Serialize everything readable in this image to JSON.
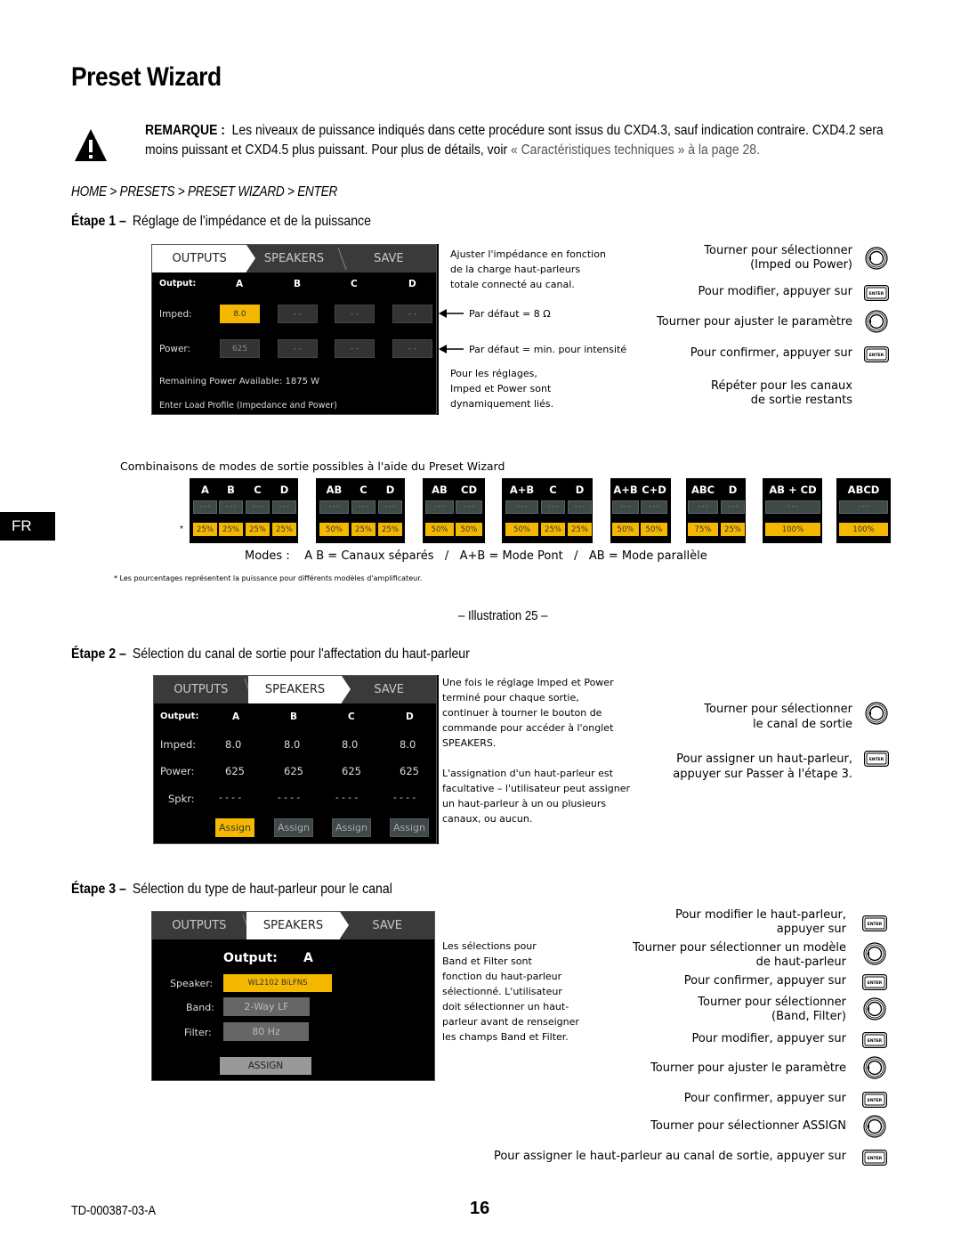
{
  "title": "Preset Wizard",
  "note": {
    "label": "REMARQUE :",
    "text": "Les niveaux de puissance indiqués dans cette procédure sont issus du CXD4.3, sauf indication contraire. CXD4.2 sera moins puissant et CXD4.5 plus puissant. Pour plus de détails, voir",
    "link": "« Caractéristiques techniques » à la page 28.",
    "icon": "warning-icon"
  },
  "breadcrumb": "HOME > PRESETS > PRESET WIZARD > ENTER",
  "step1": {
    "label": "Étape 1 –",
    "title": "Réglage de l'impédance et de la puissance",
    "screen": {
      "tabs": [
        "OUTPUTS",
        "SPEAKERS",
        "SAVE"
      ],
      "active_tab": "OUTPUTS",
      "output_label": "Output:",
      "channels": [
        "A",
        "B",
        "C",
        "D"
      ],
      "imped_label": "Imped:",
      "imped_values": [
        "8.0",
        "- -",
        "- -",
        "- -"
      ],
      "power_label": "Power:",
      "power_values": [
        "625",
        "- -",
        "- -",
        "- -"
      ],
      "remaining": "Remaining Power Available:  1875 W",
      "footer": "Enter Load Profile (Impedance and Power)"
    },
    "desc_top": [
      "Ajuster l'impédance en fonction",
      "de la charge haut-parleurs",
      "totale connecté au canal."
    ],
    "arrow_imped": "Par défaut = 8 Ω",
    "arrow_power": "Par défaut = min. pour intensité",
    "desc_bottom": [
      "Pour les réglages,",
      "Imped et Power sont",
      "dynamiquement liés."
    ],
    "instructions": [
      {
        "text": [
          "Tourner pour sélectionner",
          "(Imped ou Power)"
        ],
        "icon": "knob"
      },
      {
        "text": [
          "Pour modifier, appuyer sur"
        ],
        "icon": "enter"
      },
      {
        "text": [
          "Tourner pour ajuster le paramètre"
        ],
        "icon": "knob"
      },
      {
        "text": [
          "Pour confirmer, appuyer sur"
        ],
        "icon": "enter"
      },
      {
        "text": [
          "Répéter pour les canaux",
          "de sortie restants"
        ],
        "icon": ""
      }
    ]
  },
  "combos": {
    "caption": "Combinaisons de modes de sortie possibles à l'aide du Preset Wizard",
    "asterisk": "*",
    "dots": "- - -",
    "groups": [
      {
        "headers": [
          "A",
          "B",
          "C",
          "D"
        ],
        "percents": [
          "25%",
          "25%",
          "25%",
          "25%"
        ]
      },
      {
        "headers": [
          "AB",
          "C",
          "D"
        ],
        "percents": [
          "50%",
          "25%",
          "25%"
        ]
      },
      {
        "headers": [
          "AB",
          "CD"
        ],
        "percents": [
          "50%",
          "50%"
        ]
      },
      {
        "headers": [
          "A+B",
          "C",
          "D"
        ],
        "percents": [
          "50%",
          "25%",
          "25%"
        ]
      },
      {
        "headers": [
          "A+B",
          "C+D"
        ],
        "percents": [
          "50%",
          "50%"
        ]
      },
      {
        "headers": [
          "ABC",
          "D"
        ],
        "percents": [
          "75%",
          "25%"
        ]
      },
      {
        "headers": [
          "AB + CD"
        ],
        "percents": [
          "100%"
        ]
      },
      {
        "headers": [
          "ABCD"
        ],
        "percents": [
          "100%"
        ]
      }
    ],
    "modes": "Modes :    A B = Canaux séparés   /   A+B = Mode Pont   /   AB = Mode parallèle",
    "footnote": "* Les pourcentages représentent la puissance pour différents modèles d'amplificateur."
  },
  "fr_tab": "FR",
  "illustration": "– Illustration 25 –",
  "step2": {
    "label": "Étape 2 –",
    "title": "Sélection du canal de sortie pour l'affectation du haut-parleur",
    "screen": {
      "tabs": [
        "OUTPUTS",
        "SPEAKERS",
        "SAVE"
      ],
      "active_tab": "SPEAKERS",
      "output_label": "Output:",
      "channels": [
        "A",
        "B",
        "C",
        "D"
      ],
      "imped_label": "Imped:",
      "imped_values": [
        "8.0",
        "8.0",
        "8.0",
        "8.0"
      ],
      "power_label": "Power:",
      "power_values": [
        "625",
        "625",
        "625",
        "625"
      ],
      "spkr_label": "Spkr:",
      "spkr_values": [
        "- - - -",
        "- - - -",
        "- - - -",
        "- - - -"
      ],
      "assign_labels": [
        "Assign",
        "Assign",
        "Assign",
        "Assign"
      ]
    },
    "desc_top": [
      "Une fois le réglage Imped et Power",
      "terminé pour chaque sortie,",
      "continuer à tourner le bouton de",
      "commande pour accéder à l'onglet",
      "SPEAKERS."
    ],
    "desc_bottom": [
      "L'assignation d'un haut-parleur est",
      "facultative – l'utilisateur peut assigner",
      "un haut-parleur à un ou plusieurs",
      "canaux, ou aucun."
    ],
    "instructions": [
      {
        "text": [
          "Tourner pour sélectionner",
          "le canal de sortie"
        ],
        "icon": "knob"
      },
      {
        "text": [
          "Pour assigner un haut-parleur,",
          "appuyer sur Passer à l'étape 3."
        ],
        "icon": "enter"
      }
    ]
  },
  "step3": {
    "label": "Étape 3 –",
    "title": "Sélection du type de haut-parleur pour le canal",
    "screen": {
      "tabs": [
        "OUTPUTS",
        "SPEAKERS",
        "SAVE"
      ],
      "active_tab": "SPEAKERS",
      "output_label": "Output:",
      "output_value": "A",
      "speaker_label": "Speaker:",
      "speaker_value": "WL2102 BiLFNS",
      "band_label": "Band:",
      "band_value": "2-Way LF",
      "filter_label": "Filter:",
      "filter_value": "80 Hz",
      "assign_label": "ASSIGN"
    },
    "desc": [
      "Les sélections pour",
      "Band et Filter sont",
      "fonction du haut-parleur",
      "sélectionné. L'utilisateur",
      "doit sélectionner un haut-",
      "parleur avant de renseigner",
      "les champs Band et Filter."
    ],
    "instructions": [
      {
        "text": [
          "Pour modifier le haut-parleur,",
          "appuyer sur"
        ],
        "icon": "enter"
      },
      {
        "text": [
          "Tourner pour sélectionner un modèle",
          "de haut-parleur"
        ],
        "icon": "knob"
      },
      {
        "text": [
          "Pour confirmer, appuyer sur"
        ],
        "icon": "enter"
      },
      {
        "text": [
          "Tourner pour sélectionner",
          "(Band, Filter)"
        ],
        "icon": "knob"
      },
      {
        "text": [
          "Pour modifier, appuyer sur"
        ],
        "icon": "enter"
      },
      {
        "text": [
          "Tourner pour ajuster le paramètre"
        ],
        "icon": "knob"
      },
      {
        "text": [
          "Pour confirmer, appuyer sur"
        ],
        "icon": "enter"
      },
      {
        "text": [
          "Tourner pour sélectionner ASSIGN"
        ],
        "icon": "knob"
      },
      {
        "text": [
          "Pour assigner le haut-parleur au canal de sortie, appuyer sur"
        ],
        "icon": "enter"
      }
    ]
  },
  "footer": {
    "doc_id": "TD-000387-03-A",
    "page": "16"
  },
  "enter_label": "ENTER"
}
